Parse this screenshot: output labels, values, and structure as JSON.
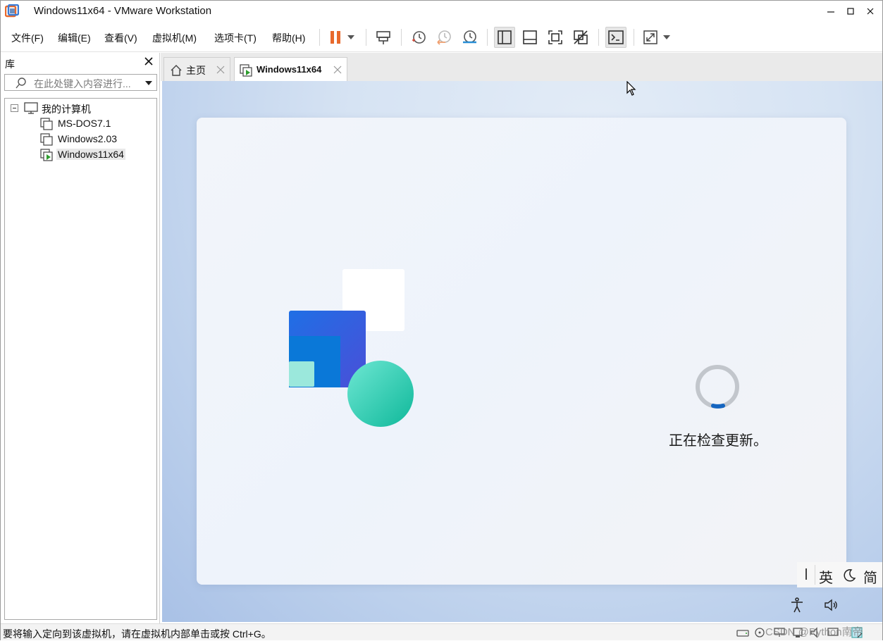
{
  "window": {
    "title": "Windows11x64 - VMware Workstation"
  },
  "menu": [
    {
      "label": "文件(F)"
    },
    {
      "label": "编辑(E)"
    },
    {
      "label": "查看(V)"
    },
    {
      "label": "虚拟机(M)"
    },
    {
      "label": "选项卡(T)"
    },
    {
      "label": "帮助(H)"
    }
  ],
  "toolbar": {
    "icons": [
      "pause-icon",
      "dropdown-icon",
      "send-ctrl-alt-del-icon",
      "snapshot-icon",
      "revert-snapshot-icon",
      "snapshot-manager-icon",
      "show-library-icon",
      "thumbnail-bar-icon",
      "full-screen-icon",
      "unity-icon",
      "console-view-icon",
      "stretch-icon"
    ]
  },
  "library": {
    "title": "库",
    "search_placeholder": "在此处键入内容进行...",
    "root": "我的计算机",
    "items": [
      {
        "label": "MS-DOS7.1"
      },
      {
        "label": "Windows2.03"
      },
      {
        "label": "Windows11x64"
      }
    ]
  },
  "tabs": [
    {
      "label": "主页"
    },
    {
      "label": "Windows11x64"
    }
  ],
  "vm": {
    "status_text": "正在检查更新。",
    "ime": {
      "mode": "英",
      "layout": "简"
    }
  },
  "statusbar": {
    "text": "要将输入定向到该虚拟机，请在虚拟机内部单击或按 Ctrl+G。",
    "watermark": "CSDN @Python南帝"
  },
  "colors": {
    "pause_orange": "#e8692c",
    "spinner_blue": "#1565c0",
    "logo_blue": "#1e6fe0",
    "logo_teal": "#17c9a9"
  }
}
